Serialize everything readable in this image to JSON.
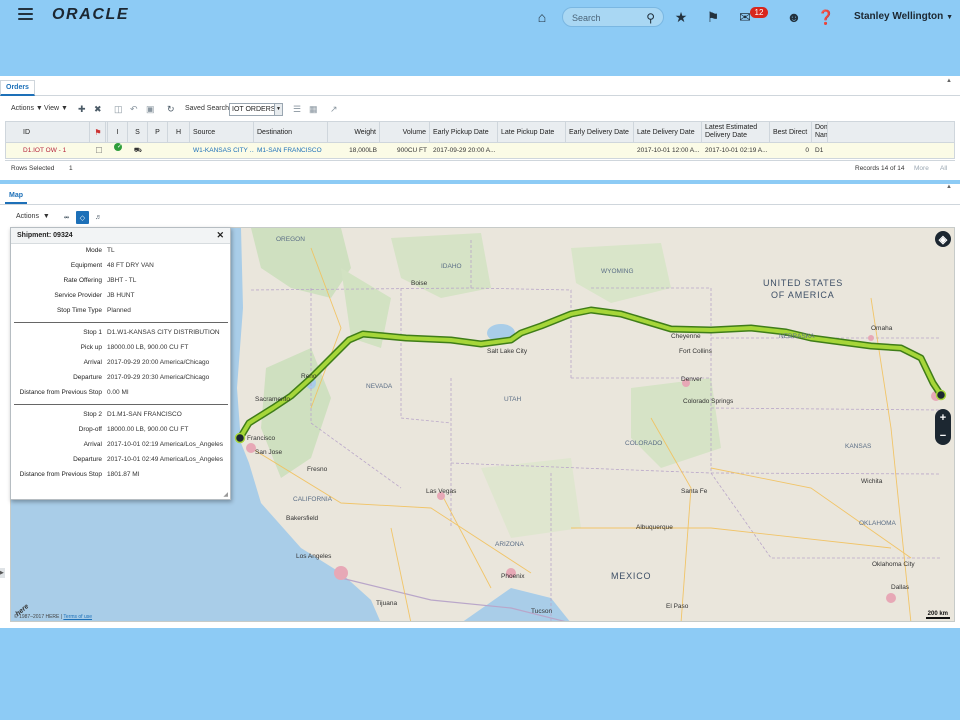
{
  "header": {
    "logo": "ORACLE",
    "search_placeholder": "Search",
    "notifications_count": "12",
    "user_name": "Stanley Wellington"
  },
  "orders": {
    "tab_label": "Orders",
    "toolbar": {
      "actions": "Actions",
      "view": "View",
      "saved_search_label": "Saved Search",
      "saved_search_value": "IOT ORDERS"
    },
    "columns": [
      "ID",
      "",
      "I",
      "S",
      "P",
      "H",
      "Source",
      "Destination",
      "Weight",
      "Volume",
      "Early Pickup Date",
      "Late Pickup Date",
      "Early Delivery Date",
      "Late Delivery Date",
      "Latest Estimated Delivery Date",
      "Best Direct",
      "Dom Nam"
    ],
    "row": {
      "id": "D1.IOT OW - 1",
      "source": "W1-KANSAS CITY ...",
      "destination": "M1-SAN FRANCISCO",
      "weight": "18,000LB",
      "volume": "900CU FT",
      "early_pickup": "2017-09-29 20:00 A...",
      "late_pickup": "",
      "early_delivery": "",
      "late_delivery": "2017-10-01 12:00 A...",
      "latest_estimated": "2017-10-01 02:19 A...",
      "best_direct": "0",
      "domain": "D1"
    },
    "rows_selected_label": "Rows Selected",
    "rows_selected_value": "1",
    "records": "Records 14 of 14",
    "more": "More",
    "all": "All"
  },
  "map": {
    "tab_label": "Map",
    "actions": "Actions",
    "copyright": "© 1987–2017 HERE |",
    "terms": "Terms of use",
    "scale": "200 km",
    "here_logo": "here",
    "labels": {
      "usa": "UNITED STATES",
      "usa2": "OF AMERICA",
      "mexico": "MEXICO",
      "idaho": "IDAHO",
      "wyoming": "WYOMING",
      "nevada": "NEVADA",
      "utah": "UTAH",
      "colorado": "COLORADO",
      "arizona": "ARIZONA",
      "california": "CALIFORNIA",
      "kansas": "KANSAS",
      "oregon": "OREGON",
      "nebraska": "NEBRASKA",
      "oklahoma": "OKLAHOMA",
      "sacramento": "Sacramento",
      "sanjose": "San Jose",
      "francisco": "Francisco",
      "fresno": "Fresno",
      "reno": "Reno",
      "lasvegas": "Las Vegas",
      "losangeles": "Los Angeles",
      "tijuana": "Tijuana",
      "phoenix": "Phoenix",
      "tucson": "Tucson",
      "denver": "Denver",
      "coloradosprings": "Colorado Springs",
      "albuquerque": "Albuquerque",
      "dallas": "Dallas",
      "omaha": "Omaha",
      "oklahomacity": "Oklahoma City",
      "wichita": "Wichita",
      "saltlake": "Salt Lake City",
      "cheyenne": "Cheyenne",
      "fortcollins": "Fort Collins",
      "boise": "Boise",
      "bakersfield": "Bakersfield",
      "elpaso": "El Paso",
      "santafe": "Santa Fe"
    }
  },
  "shipment": {
    "title": "Shipment: 09324",
    "fields": [
      {
        "k": "Mode",
        "v": "TL"
      },
      {
        "k": "Equipment",
        "v": "48 FT DRY VAN"
      },
      {
        "k": "Rate Offering",
        "v": "JBHT - TL"
      },
      {
        "k": "Service Provider",
        "v": "JB HUNT"
      },
      {
        "k": "Stop Time Type",
        "v": "Planned"
      }
    ],
    "stop1": [
      {
        "k": "Stop 1",
        "v": "D1.W1-KANSAS CITY DISTRIBUTION"
      },
      {
        "k": "Pick up",
        "v": "18000.00 LB, 900.00 CU FT"
      },
      {
        "k": "Arrival",
        "v": "2017-09-29 20:00 America/Chicago"
      },
      {
        "k": "Departure",
        "v": "2017-09-29 20:30 America/Chicago"
      },
      {
        "k": "Distance from Previous Stop",
        "v": "0.00 MI"
      }
    ],
    "stop2": [
      {
        "k": "Stop 2",
        "v": "D1.M1-SAN FRANCISCO"
      },
      {
        "k": "Drop-off",
        "v": "18000.00 LB, 900.00 CU FT"
      },
      {
        "k": "Arrival",
        "v": "2017-10-01 02:19 America/Los_Angeles"
      },
      {
        "k": "Departure",
        "v": "2017-10-01 02:49 America/Los_Angeles"
      },
      {
        "k": "Distance from Previous Stop",
        "v": "1801.87 MI"
      }
    ]
  }
}
